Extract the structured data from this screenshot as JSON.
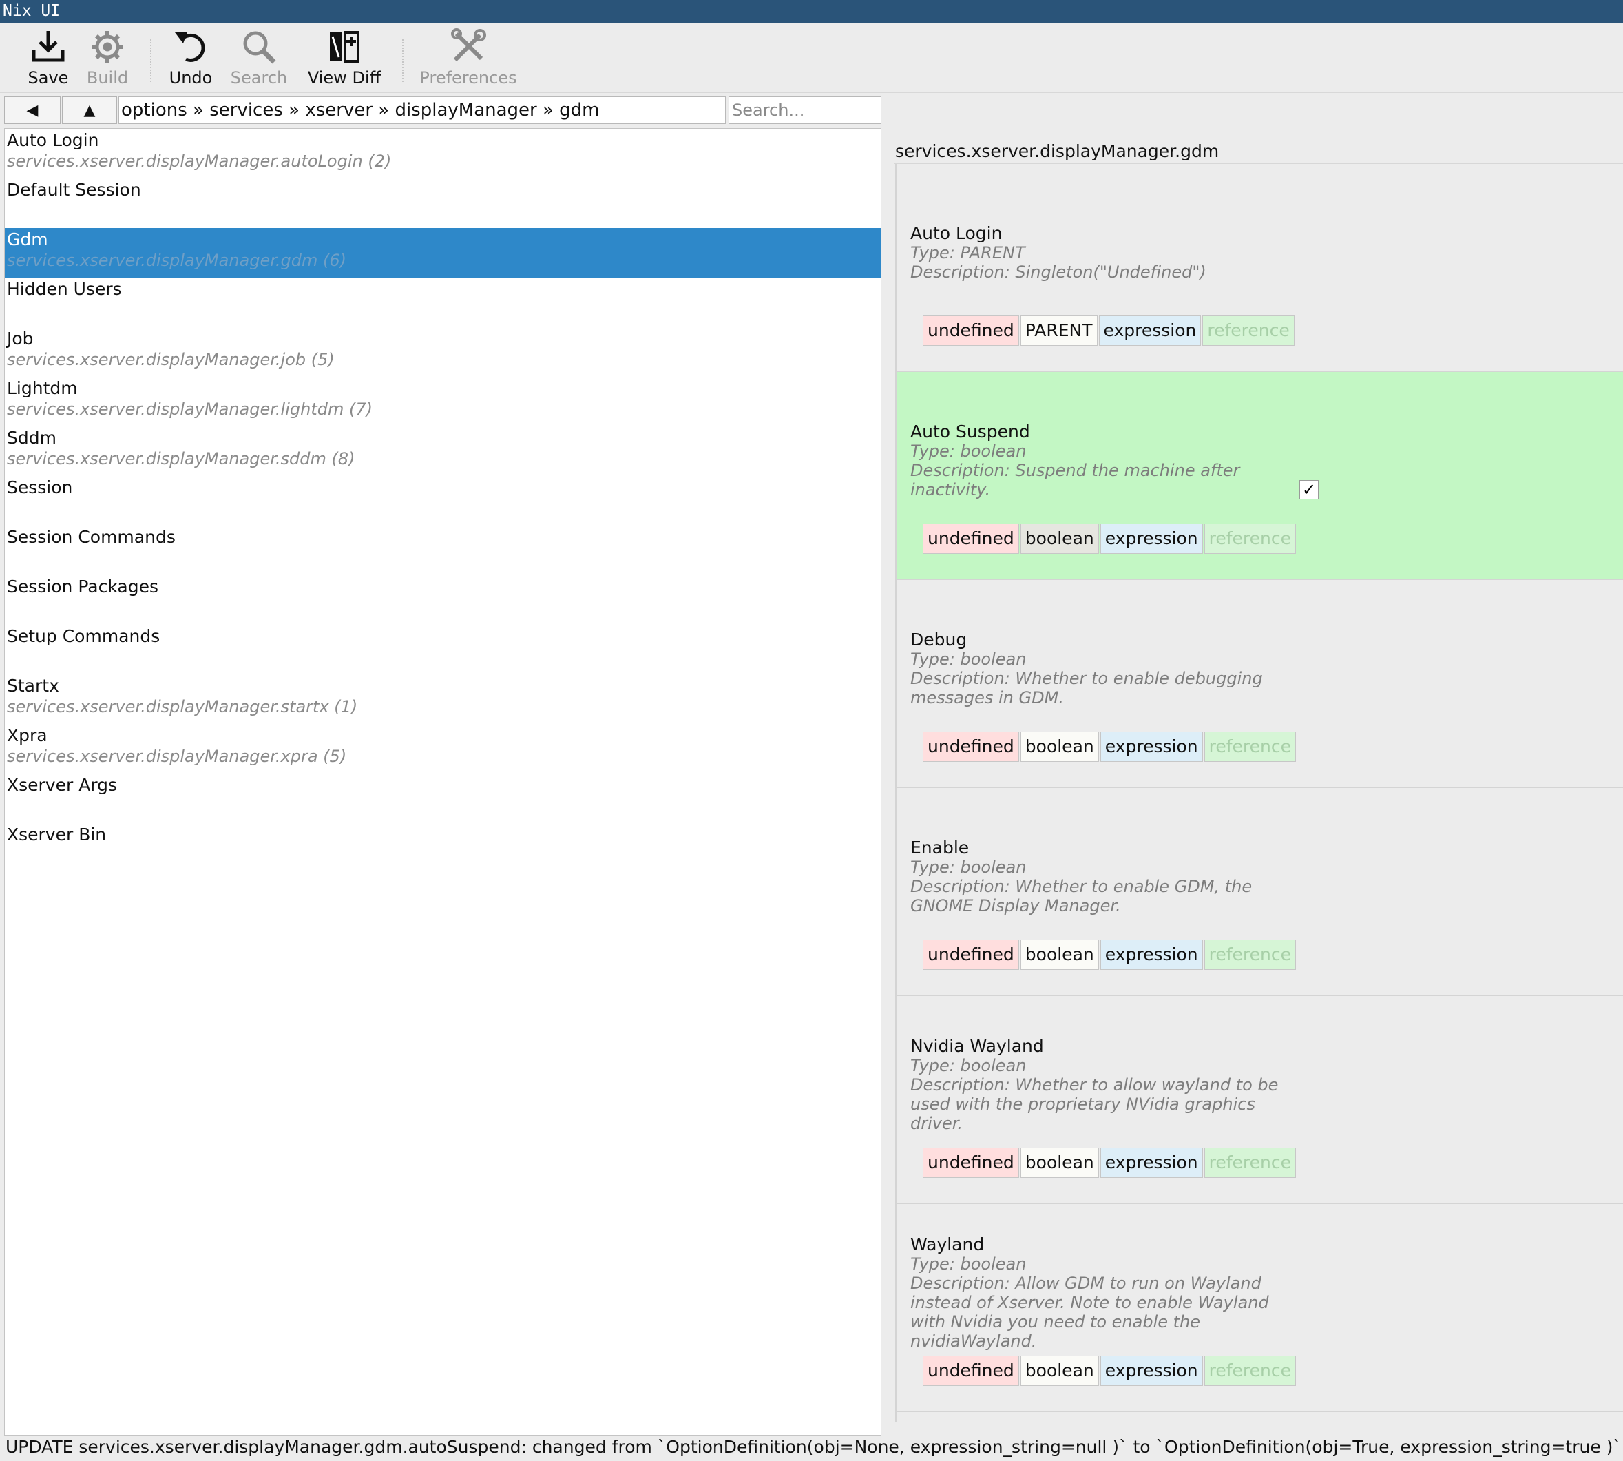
{
  "window": {
    "title": "Nix UI"
  },
  "toolbar": {
    "save": {
      "label": "Save",
      "icon": "download-icon",
      "enabled": true
    },
    "build": {
      "label": "Build",
      "icon": "gear-icon",
      "enabled": false
    },
    "undo": {
      "label": "Undo",
      "icon": "undo-icon",
      "enabled": true
    },
    "search": {
      "label": "Search",
      "icon": "magnifier-icon",
      "enabled": false
    },
    "view_diff": {
      "label": "View Diff",
      "icon": "diff-icon",
      "enabled": true
    },
    "preferences": {
      "label": "Preferences",
      "icon": "tools-icon",
      "enabled": false
    }
  },
  "nav": {
    "back_glyph": "◀",
    "up_glyph": "▲",
    "breadcrumb": "options » services » xserver » displayManager » gdm",
    "search_placeholder": "Search..."
  },
  "options_list": [
    {
      "title": "Auto Login",
      "subtitle": "services.xserver.displayManager.autoLogin (2)",
      "selected": false
    },
    {
      "title": "Default Session",
      "subtitle": "",
      "selected": false
    },
    {
      "title": "Gdm",
      "subtitle": "services.xserver.displayManager.gdm (6)",
      "selected": true
    },
    {
      "title": "Hidden Users",
      "subtitle": "",
      "selected": false
    },
    {
      "title": "Job",
      "subtitle": "services.xserver.displayManager.job (5)",
      "selected": false
    },
    {
      "title": "Lightdm",
      "subtitle": "services.xserver.displayManager.lightdm (7)",
      "selected": false
    },
    {
      "title": "Sddm",
      "subtitle": "services.xserver.displayManager.sddm (8)",
      "selected": false
    },
    {
      "title": "Session",
      "subtitle": "",
      "selected": false
    },
    {
      "title": "Session Commands",
      "subtitle": "",
      "selected": false
    },
    {
      "title": "Session Packages",
      "subtitle": "",
      "selected": false
    },
    {
      "title": "Setup Commands",
      "subtitle": "",
      "selected": false
    },
    {
      "title": "Startx",
      "subtitle": "services.xserver.displayManager.startx (1)",
      "selected": false
    },
    {
      "title": "Xpra",
      "subtitle": "services.xserver.displayManager.xpra (5)",
      "selected": false
    },
    {
      "title": "Xserver Args",
      "subtitle": "",
      "selected": false
    },
    {
      "title": "Xserver Bin",
      "subtitle": "",
      "selected": false
    }
  ],
  "details": {
    "header": "services.xserver.displayManager.gdm",
    "cards": [
      {
        "name": "Auto Login",
        "type": "Type: PARENT",
        "description": [
          "Description: Singleton(\"Undefined\")"
        ],
        "changed": false,
        "checkbox": null,
        "tabs": [
          "undefined",
          "PARENT",
          "expression",
          "reference"
        ]
      },
      {
        "name": "Auto Suspend",
        "type": "Type: boolean",
        "description": [
          "Description: Suspend the machine after",
          "inactivity."
        ],
        "changed": true,
        "checkbox": "✓",
        "tabs": [
          "undefined",
          "boolean",
          "expression",
          "reference"
        ]
      },
      {
        "name": "Debug",
        "type": "Type: boolean",
        "description": [
          "Description: Whether to enable debugging",
          "messages in GDM."
        ],
        "changed": false,
        "checkbox": null,
        "tabs": [
          "undefined",
          "boolean",
          "expression",
          "reference"
        ]
      },
      {
        "name": "Enable",
        "type": "Type: boolean",
        "description": [
          "Description: Whether to enable GDM, the",
          "GNOME Display Manager."
        ],
        "changed": false,
        "checkbox": null,
        "tabs": [
          "undefined",
          "boolean",
          "expression",
          "reference"
        ]
      },
      {
        "name": "Nvidia Wayland",
        "type": "Type: boolean",
        "description": [
          "Description: Whether to allow wayland to be",
          "used with the proprietary NVidia graphics",
          "driver."
        ],
        "changed": false,
        "checkbox": null,
        "tabs": [
          "undefined",
          "boolean",
          "expression",
          "reference"
        ]
      },
      {
        "name": "Wayland",
        "type": "Type: boolean",
        "description": [
          "Description: Allow GDM to run on Wayland",
          "instead of Xserver. Note to enable Wayland",
          "with Nvidia you need to enable the",
          "nvidiaWayland."
        ],
        "changed": false,
        "checkbox": null,
        "tabs": [
          "undefined",
          "boolean",
          "expression",
          "reference"
        ]
      }
    ]
  },
  "status": {
    "message": "UPDATE services.xserver.displayManager.gdm.autoSuspend: changed from `OptionDefinition(obj=None, expression_string=null )` to `OptionDefinition(obj=True, expression_string=true )`"
  },
  "colors": {
    "titlebar": "#2a5479",
    "selection": "#2e88c9",
    "changed_card": "#c3f7c4",
    "tab_undefined": "#ffdede",
    "tab_expression": "#ddeef8",
    "tab_reference": "#d6f5d6"
  }
}
